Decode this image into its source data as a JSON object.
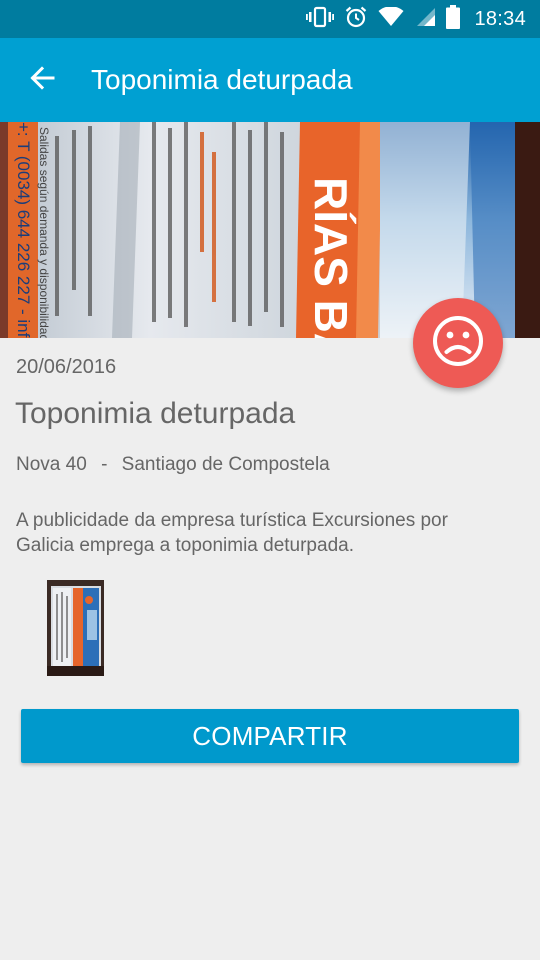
{
  "status_bar": {
    "time": "18:34",
    "icons": [
      "vibrate-icon",
      "alarm-icon",
      "wifi-icon",
      "signal-icon",
      "battery-icon"
    ]
  },
  "toolbar": {
    "back_icon": "arrow-back-icon",
    "title": "Toponimia deturpada"
  },
  "header_image": {
    "photo_text": [
      "RÍAS BA",
      "+: T (0034) 644 226 227 - info",
      "Salidas según demanda y disponibilidad"
    ]
  },
  "mood_icon": "sad-face-icon",
  "report": {
    "date": "20/06/2016",
    "title": "Toponimia deturpada",
    "address": "Nova 40",
    "location_separator": "-",
    "city": "Santiago de Compostela",
    "description": "A publicidade da empresa turística Excursiones por Galicia emprega a toponimia deturpada."
  },
  "share_button": {
    "label": "COMPARTIR"
  },
  "colors": {
    "status_bar": "#007c9f",
    "toolbar": "#00a0d2",
    "sad_badge": "#ee5a55",
    "share_button": "#0099cc",
    "background": "#eeeeee",
    "text": "#666666"
  }
}
